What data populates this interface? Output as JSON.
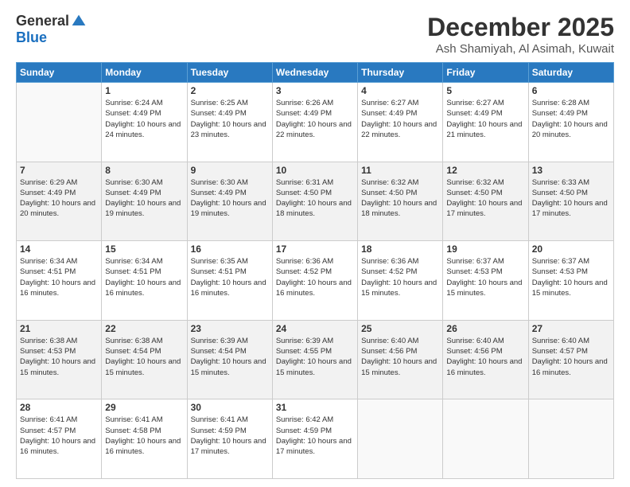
{
  "logo": {
    "general": "General",
    "blue": "Blue"
  },
  "header": {
    "month": "December 2025",
    "location": "Ash Shamiyah, Al Asimah, Kuwait"
  },
  "days_of_week": [
    "Sunday",
    "Monday",
    "Tuesday",
    "Wednesday",
    "Thursday",
    "Friday",
    "Saturday"
  ],
  "weeks": [
    [
      {
        "day": "",
        "sunrise": "",
        "sunset": "",
        "daylight": ""
      },
      {
        "day": "1",
        "sunrise": "Sunrise: 6:24 AM",
        "sunset": "Sunset: 4:49 PM",
        "daylight": "Daylight: 10 hours and 24 minutes."
      },
      {
        "day": "2",
        "sunrise": "Sunrise: 6:25 AM",
        "sunset": "Sunset: 4:49 PM",
        "daylight": "Daylight: 10 hours and 23 minutes."
      },
      {
        "day": "3",
        "sunrise": "Sunrise: 6:26 AM",
        "sunset": "Sunset: 4:49 PM",
        "daylight": "Daylight: 10 hours and 22 minutes."
      },
      {
        "day": "4",
        "sunrise": "Sunrise: 6:27 AM",
        "sunset": "Sunset: 4:49 PM",
        "daylight": "Daylight: 10 hours and 22 minutes."
      },
      {
        "day": "5",
        "sunrise": "Sunrise: 6:27 AM",
        "sunset": "Sunset: 4:49 PM",
        "daylight": "Daylight: 10 hours and 21 minutes."
      },
      {
        "day": "6",
        "sunrise": "Sunrise: 6:28 AM",
        "sunset": "Sunset: 4:49 PM",
        "daylight": "Daylight: 10 hours and 20 minutes."
      }
    ],
    [
      {
        "day": "7",
        "sunrise": "Sunrise: 6:29 AM",
        "sunset": "Sunset: 4:49 PM",
        "daylight": "Daylight: 10 hours and 20 minutes."
      },
      {
        "day": "8",
        "sunrise": "Sunrise: 6:30 AM",
        "sunset": "Sunset: 4:49 PM",
        "daylight": "Daylight: 10 hours and 19 minutes."
      },
      {
        "day": "9",
        "sunrise": "Sunrise: 6:30 AM",
        "sunset": "Sunset: 4:49 PM",
        "daylight": "Daylight: 10 hours and 19 minutes."
      },
      {
        "day": "10",
        "sunrise": "Sunrise: 6:31 AM",
        "sunset": "Sunset: 4:50 PM",
        "daylight": "Daylight: 10 hours and 18 minutes."
      },
      {
        "day": "11",
        "sunrise": "Sunrise: 6:32 AM",
        "sunset": "Sunset: 4:50 PM",
        "daylight": "Daylight: 10 hours and 18 minutes."
      },
      {
        "day": "12",
        "sunrise": "Sunrise: 6:32 AM",
        "sunset": "Sunset: 4:50 PM",
        "daylight": "Daylight: 10 hours and 17 minutes."
      },
      {
        "day": "13",
        "sunrise": "Sunrise: 6:33 AM",
        "sunset": "Sunset: 4:50 PM",
        "daylight": "Daylight: 10 hours and 17 minutes."
      }
    ],
    [
      {
        "day": "14",
        "sunrise": "Sunrise: 6:34 AM",
        "sunset": "Sunset: 4:51 PM",
        "daylight": "Daylight: 10 hours and 16 minutes."
      },
      {
        "day": "15",
        "sunrise": "Sunrise: 6:34 AM",
        "sunset": "Sunset: 4:51 PM",
        "daylight": "Daylight: 10 hours and 16 minutes."
      },
      {
        "day": "16",
        "sunrise": "Sunrise: 6:35 AM",
        "sunset": "Sunset: 4:51 PM",
        "daylight": "Daylight: 10 hours and 16 minutes."
      },
      {
        "day": "17",
        "sunrise": "Sunrise: 6:36 AM",
        "sunset": "Sunset: 4:52 PM",
        "daylight": "Daylight: 10 hours and 16 minutes."
      },
      {
        "day": "18",
        "sunrise": "Sunrise: 6:36 AM",
        "sunset": "Sunset: 4:52 PM",
        "daylight": "Daylight: 10 hours and 15 minutes."
      },
      {
        "day": "19",
        "sunrise": "Sunrise: 6:37 AM",
        "sunset": "Sunset: 4:53 PM",
        "daylight": "Daylight: 10 hours and 15 minutes."
      },
      {
        "day": "20",
        "sunrise": "Sunrise: 6:37 AM",
        "sunset": "Sunset: 4:53 PM",
        "daylight": "Daylight: 10 hours and 15 minutes."
      }
    ],
    [
      {
        "day": "21",
        "sunrise": "Sunrise: 6:38 AM",
        "sunset": "Sunset: 4:53 PM",
        "daylight": "Daylight: 10 hours and 15 minutes."
      },
      {
        "day": "22",
        "sunrise": "Sunrise: 6:38 AM",
        "sunset": "Sunset: 4:54 PM",
        "daylight": "Daylight: 10 hours and 15 minutes."
      },
      {
        "day": "23",
        "sunrise": "Sunrise: 6:39 AM",
        "sunset": "Sunset: 4:54 PM",
        "daylight": "Daylight: 10 hours and 15 minutes."
      },
      {
        "day": "24",
        "sunrise": "Sunrise: 6:39 AM",
        "sunset": "Sunset: 4:55 PM",
        "daylight": "Daylight: 10 hours and 15 minutes."
      },
      {
        "day": "25",
        "sunrise": "Sunrise: 6:40 AM",
        "sunset": "Sunset: 4:56 PM",
        "daylight": "Daylight: 10 hours and 15 minutes."
      },
      {
        "day": "26",
        "sunrise": "Sunrise: 6:40 AM",
        "sunset": "Sunset: 4:56 PM",
        "daylight": "Daylight: 10 hours and 16 minutes."
      },
      {
        "day": "27",
        "sunrise": "Sunrise: 6:40 AM",
        "sunset": "Sunset: 4:57 PM",
        "daylight": "Daylight: 10 hours and 16 minutes."
      }
    ],
    [
      {
        "day": "28",
        "sunrise": "Sunrise: 6:41 AM",
        "sunset": "Sunset: 4:57 PM",
        "daylight": "Daylight: 10 hours and 16 minutes."
      },
      {
        "day": "29",
        "sunrise": "Sunrise: 6:41 AM",
        "sunset": "Sunset: 4:58 PM",
        "daylight": "Daylight: 10 hours and 16 minutes."
      },
      {
        "day": "30",
        "sunrise": "Sunrise: 6:41 AM",
        "sunset": "Sunset: 4:59 PM",
        "daylight": "Daylight: 10 hours and 17 minutes."
      },
      {
        "day": "31",
        "sunrise": "Sunrise: 6:42 AM",
        "sunset": "Sunset: 4:59 PM",
        "daylight": "Daylight: 10 hours and 17 minutes."
      },
      {
        "day": "",
        "sunrise": "",
        "sunset": "",
        "daylight": ""
      },
      {
        "day": "",
        "sunrise": "",
        "sunset": "",
        "daylight": ""
      },
      {
        "day": "",
        "sunrise": "",
        "sunset": "",
        "daylight": ""
      }
    ]
  ]
}
